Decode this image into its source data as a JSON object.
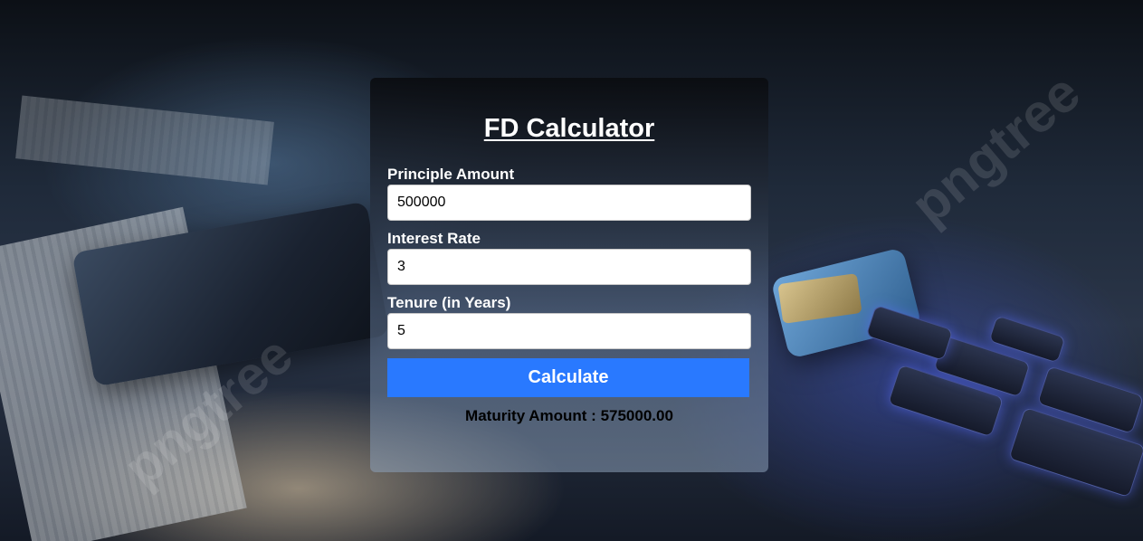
{
  "form": {
    "title": "FD Calculator",
    "principal_label": "Principle Amount",
    "principal_value": "500000",
    "rate_label": "Interest Rate",
    "rate_value": "3",
    "tenure_label": "Tenure (in Years)",
    "tenure_value": "5",
    "calculate_label": "Calculate",
    "result_text": "Maturity Amount : 575000.00"
  },
  "background": {
    "watermark_text": "pngtree"
  },
  "colors": {
    "button": "#2979ff",
    "title": "#ffffff",
    "result": "#000000"
  }
}
